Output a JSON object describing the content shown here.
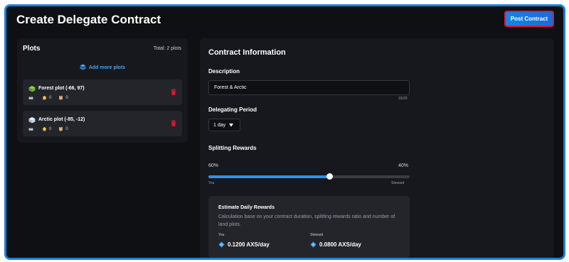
{
  "header": {
    "title": "Create Delegate Contract",
    "post_button": "Post Contract"
  },
  "plots": {
    "heading": "Plots",
    "total": "Total: 2 plots",
    "add_more": "Add more plots",
    "items": [
      {
        "name": "Forest plot (-66, 97)",
        "stat1": "0",
        "stat2": "0",
        "color": "#7cc242"
      },
      {
        "name": "Arctic plot (-85, -12)",
        "stat1": "0",
        "stat2": "0",
        "color": "#cfe3f3"
      }
    ]
  },
  "contract": {
    "title": "Contract Information",
    "description_label": "Description",
    "description_value": "Forest & Arctic",
    "char_count": "15/20",
    "period_label": "Delegating Period",
    "period_value": "1 day",
    "splitting_label": "Splitting Rewards",
    "split_you_pct": "60%",
    "split_steward_pct": "40%",
    "split_value": 0.6,
    "split_you_label": "You",
    "split_steward_label": "Steward",
    "estimate": {
      "title": "Estimate Daily Rewards",
      "desc": "Calculation base on your contract duration, splitting rewards ratio and number of land plots.",
      "you_label": "You",
      "you_value": "0.1200 AXS/day",
      "steward_label": "Steward",
      "steward_value": "0.0800 AXS/day"
    }
  },
  "colors": {
    "accent": "#2f8fe8",
    "danger": "#e0192b",
    "frame": "#1f7fd6"
  }
}
